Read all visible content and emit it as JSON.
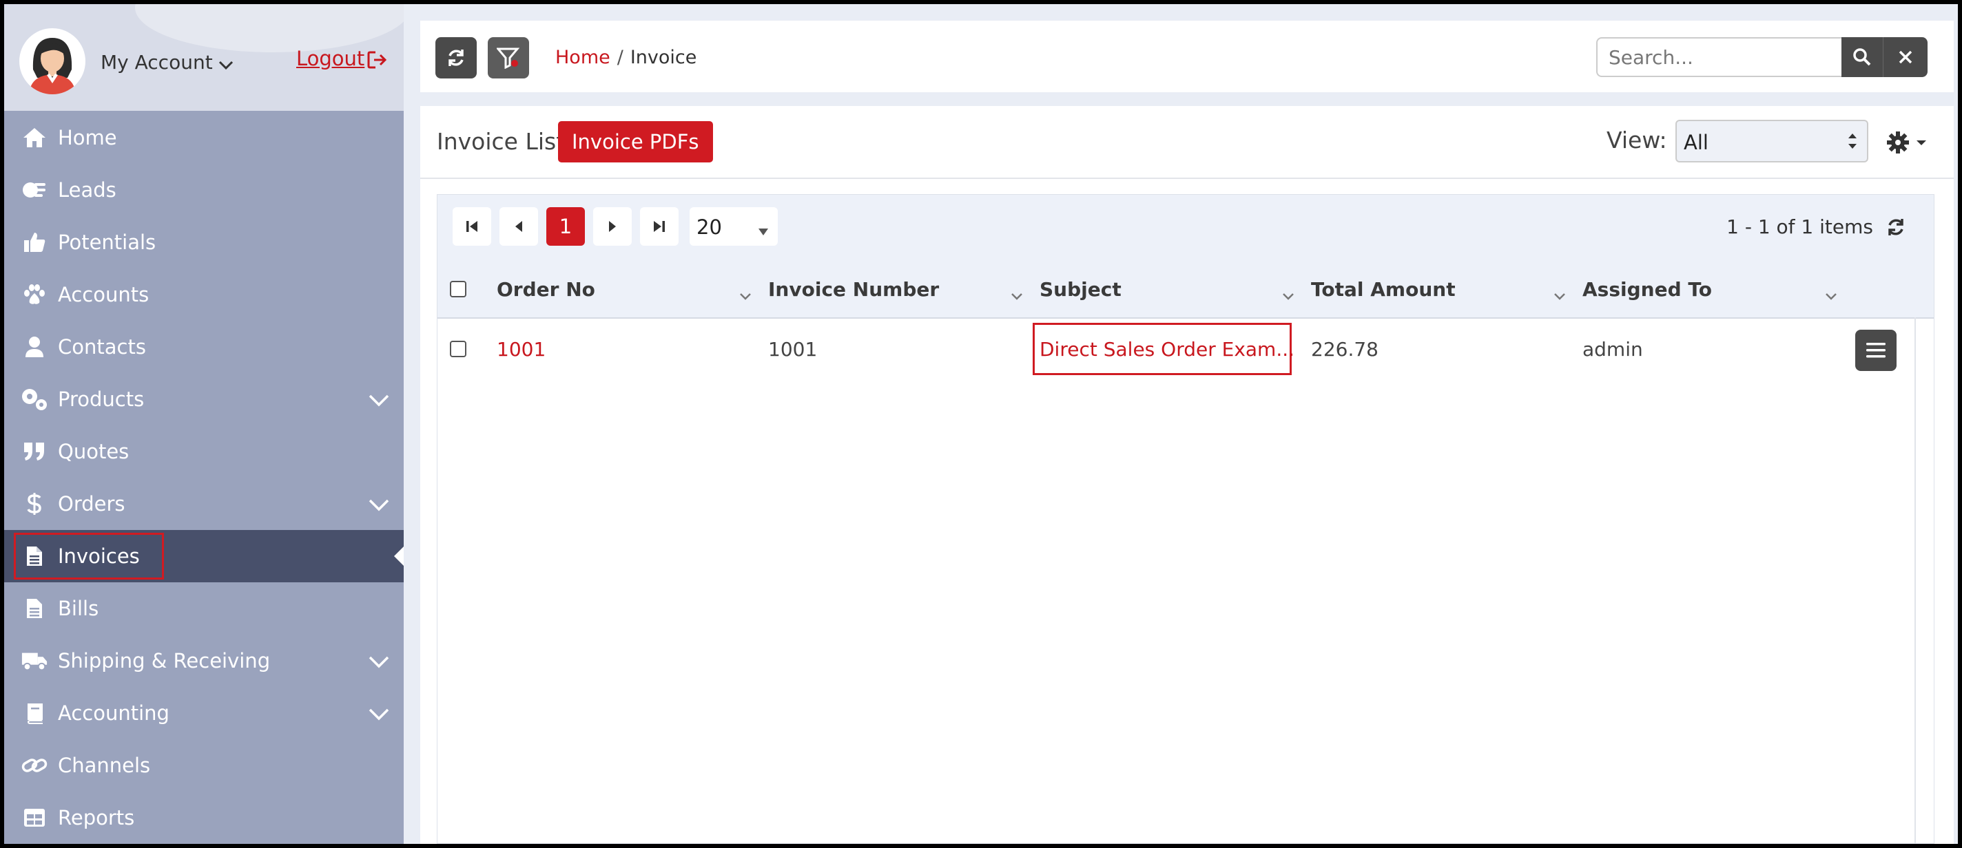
{
  "account": {
    "name": "My Account",
    "logout_label": "Logout"
  },
  "sidebar": {
    "items": [
      {
        "label": "Home",
        "icon": "home-icon"
      },
      {
        "label": "Leads",
        "icon": "leads-icon"
      },
      {
        "label": "Potentials",
        "icon": "thumbs-up-icon"
      },
      {
        "label": "Accounts",
        "icon": "paw-icon"
      },
      {
        "label": "Contacts",
        "icon": "user-icon"
      },
      {
        "label": "Products",
        "icon": "gears-icon"
      },
      {
        "label": "Quotes",
        "icon": "quote-icon"
      },
      {
        "label": "Orders",
        "icon": "dollar-icon"
      },
      {
        "label": "Invoices",
        "icon": "file-icon"
      },
      {
        "label": "Bills",
        "icon": "file-icon"
      },
      {
        "label": "Shipping & Receiving",
        "icon": "truck-icon"
      },
      {
        "label": "Accounting",
        "icon": "book-icon"
      },
      {
        "label": "Channels",
        "icon": "link-icon"
      },
      {
        "label": "Reports",
        "icon": "table-icon"
      }
    ],
    "active": "Invoices"
  },
  "topbar": {
    "breadcrumb_home": "Home",
    "breadcrumb_sep": "/",
    "breadcrumb_current": "Invoice",
    "search_placeholder": "Search..."
  },
  "panel": {
    "title": "Invoice List",
    "pdf_button": "Invoice PDFs",
    "view_label": "View:",
    "view_value": "All"
  },
  "pager": {
    "current_page": "1",
    "page_size": "20",
    "info": "1 - 1 of 1 items"
  },
  "table": {
    "columns": [
      "Order No",
      "Invoice Number",
      "Subject",
      "Total Amount",
      "Assigned To"
    ],
    "rows": [
      {
        "order_no": "1001",
        "invoice_number": "1001",
        "subject": "Direct Sales Order Exam...",
        "total_amount": "226.78",
        "assigned_to": "admin"
      }
    ]
  },
  "colors": {
    "accent_red": "#d01b22",
    "sidebar_bg": "#9aa3bd",
    "sidebar_active": "#48506b",
    "dark_button": "#4a4a4a"
  }
}
